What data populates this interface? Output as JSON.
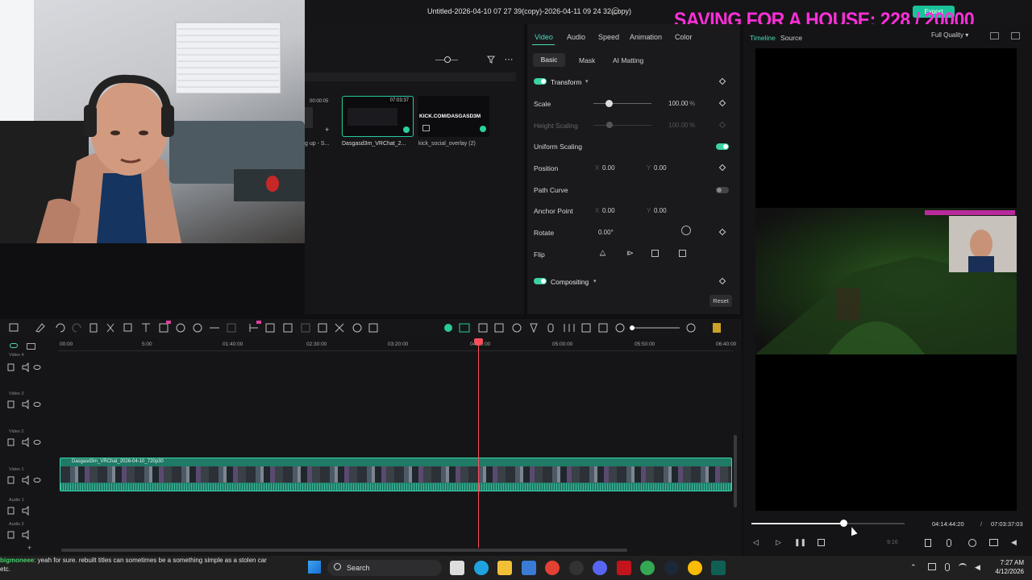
{
  "window": {
    "title": "Untitled-2026-04-10 07 27 39(copy)-2026-04-11 09 24 32(copy)",
    "export_label": "Export"
  },
  "overlay": {
    "banner": "SAVING FOR A HOUSE: 228 / 20000"
  },
  "media": {
    "clip_duration_badge": "00:00:05",
    "clip_left_name": "g up - S...",
    "clip1_duration": "07:03:37",
    "clip1_name": "Dasgasd3m_VRChat_2...",
    "clip2_brand": "KICK.COM/DASGASD3M",
    "clip2_name": "kick_social_overlay (2)"
  },
  "properties": {
    "tabs": [
      "Video",
      "Audio",
      "Speed",
      "Animation",
      "Color"
    ],
    "subtabs": [
      "Basic",
      "Mask",
      "AI Matting"
    ],
    "transform_header": "Transform",
    "scale_label": "Scale",
    "scale_value": "100.00",
    "scale_unit": "%",
    "height_scaling_label": "Height Scaling",
    "height_scaling_value": "100.00",
    "uniform_scaling_label": "Uniform Scaling",
    "position_label": "Position",
    "position_x_axis": "X",
    "position_x": "0.00",
    "position_y_axis": "Y",
    "position_y": "0.00",
    "path_curve_label": "Path Curve",
    "anchor_label": "Anchor Point",
    "anchor_x": "0.00",
    "anchor_y": "0.00",
    "rotate_label": "Rotate",
    "rotate_value": "0.00°",
    "flip_label": "Flip",
    "compositing_header": "Compositing",
    "reset_label": "Reset"
  },
  "preview": {
    "tabs": [
      "Timeline",
      "Source"
    ],
    "quality": "Full Quality",
    "current_time": "04:14:44:20",
    "separator": "/",
    "total_time": "07:03:37:03",
    "aspect": "9:16",
    "progress": 0.6
  },
  "timeline": {
    "ruler": [
      "00:00",
      "5:00",
      "01:40:00",
      "02:30:00",
      "03:20:00",
      "04:10:00",
      "05:00:00",
      "05:50:00",
      "06:40:00"
    ],
    "tracks": [
      "Video 4",
      "Video 3",
      "Video 2",
      "Video 1",
      "Audio 1",
      "Audio 2"
    ],
    "clip_label": "Dasgasd3m_VRChat_2026-04-10_720p30"
  },
  "chat": {
    "user": "bigmoneee",
    "message": ": yeah for sure. rebuilt titles can sometimes be a something simple as a stolen car etc."
  },
  "taskbar": {
    "search_placeholder": "Search",
    "time": "7:27 AM",
    "date": "4/12/2026"
  }
}
